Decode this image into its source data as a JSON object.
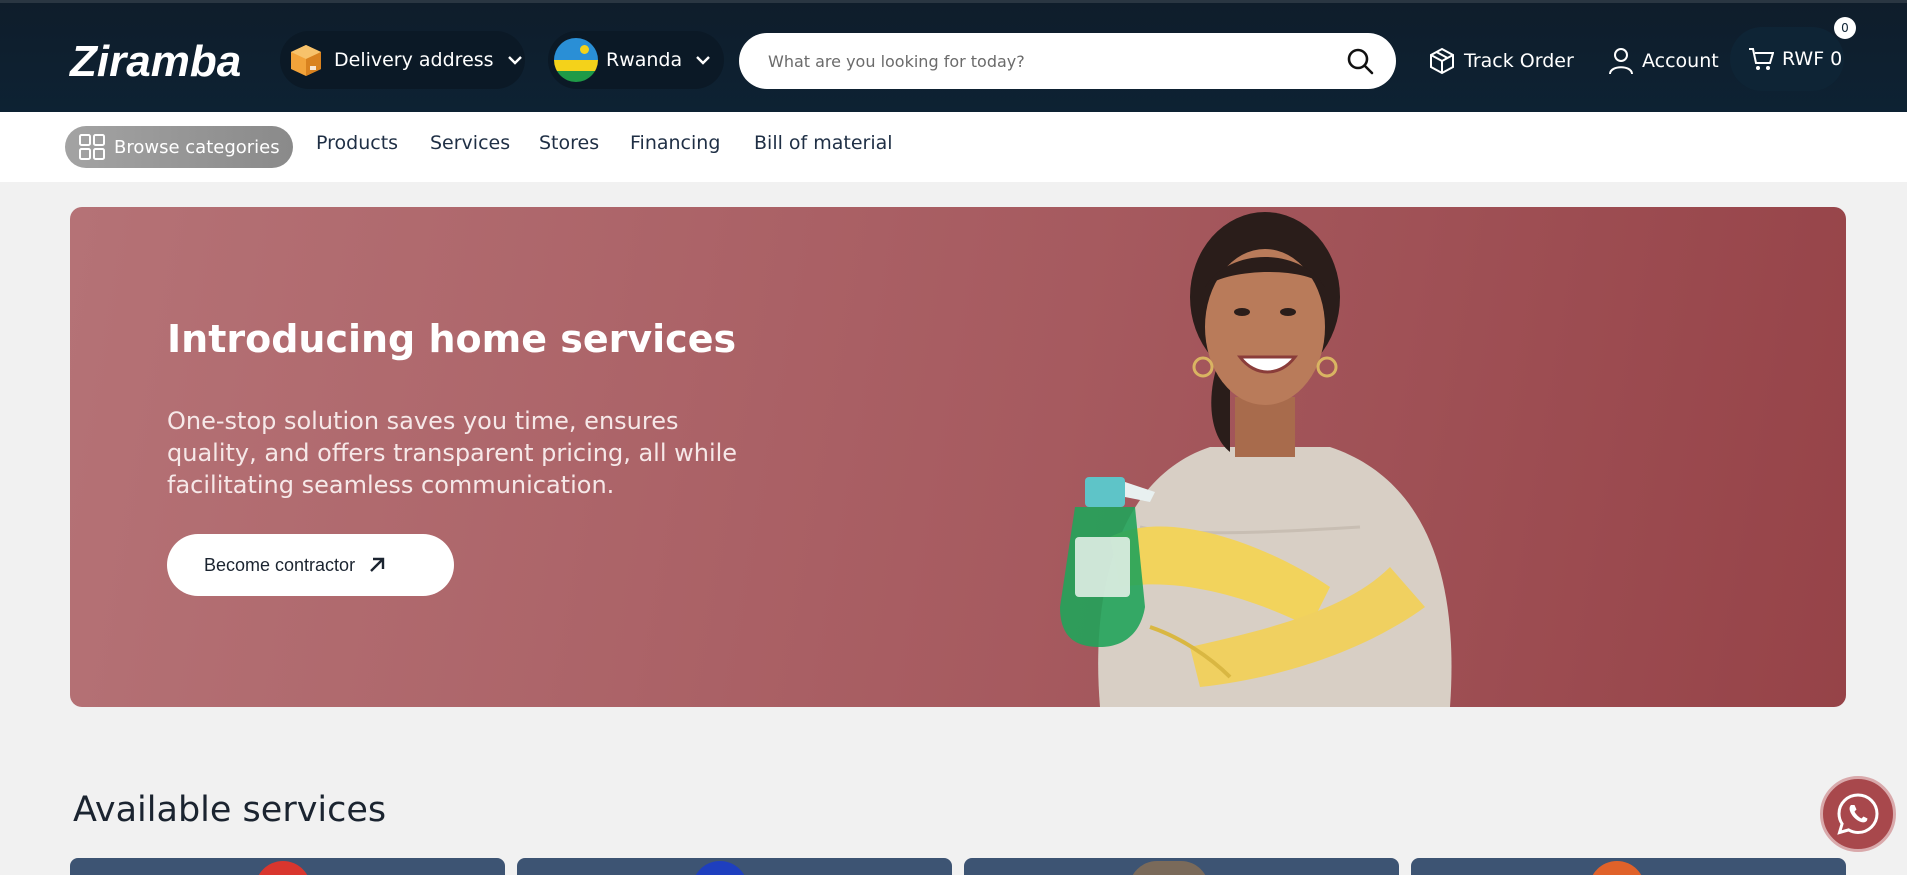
{
  "header": {
    "logo_text": "Ziramba",
    "delivery_label": "Delivery address",
    "country_label": "Rwanda",
    "search_placeholder": "What are you looking for today?",
    "track_order_label": "Track Order",
    "account_label": "Account",
    "cart_label": "RWF 0",
    "cart_count": "0"
  },
  "categories": {
    "browse_label": "Browse categories",
    "links": [
      "Products",
      "Services",
      "Stores",
      "Financing",
      "Bill of material"
    ]
  },
  "hero": {
    "title": "Introducing home services",
    "description": "One-stop solution saves you time, ensures quality, and offers transparent pricing, all while facilitating seamless communication.",
    "cta_label": "Become contractor"
  },
  "services": {
    "title": "Available services"
  },
  "colors": {
    "header_bg": "#0d2233",
    "hero_bg": "#a65a5f",
    "card_bg": "#3d5473",
    "whatsapp_bg": "#a8484c"
  },
  "icons": [
    "box-icon",
    "rwanda-flag-icon",
    "chevron-down-icon",
    "search-icon",
    "package-icon",
    "user-icon",
    "cart-icon",
    "grid-icon",
    "arrow-up-right-icon",
    "whatsapp-icon"
  ]
}
